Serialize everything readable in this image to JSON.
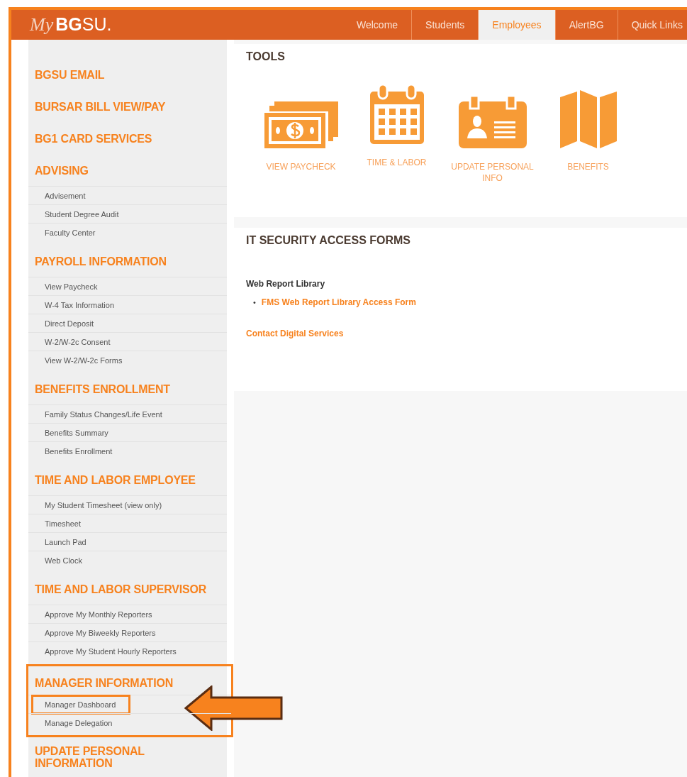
{
  "header": {
    "logo": {
      "prefix": "My",
      "name": "**BG**SU."
    },
    "tabs": [
      {
        "label": "Welcome",
        "selected": false
      },
      {
        "label": "Students",
        "selected": false
      },
      {
        "label": "Employees",
        "selected": true
      },
      {
        "label": "AlertBG",
        "selected": false
      },
      {
        "label": "Quick Links",
        "selected": false
      }
    ]
  },
  "sidebar": {
    "sections": [
      {
        "heading": "BGSU EMAIL",
        "highlighted": false
      },
      {
        "heading": "BURSAR BILL VIEW/PAY",
        "highlighted": false
      },
      {
        "heading": "BG1 CARD SERVICES",
        "highlighted": false
      },
      {
        "heading": "ADVISING",
        "highlighted": false,
        "items": [
          {
            "label": "Advisement",
            "highlighted": false
          },
          {
            "label": "Student Degree Audit",
            "highlighted": false
          },
          {
            "label": "Faculty Center",
            "highlighted": false
          }
        ]
      },
      {
        "heading": "PAYROLL INFORMATION",
        "highlighted": false,
        "items": [
          {
            "label": "View Paycheck",
            "highlighted": false
          },
          {
            "label": "W-4 Tax Information",
            "highlighted": false
          },
          {
            "label": "Direct Deposit",
            "highlighted": false
          },
          {
            "label": "W-2/W-2c Consent",
            "highlighted": false
          },
          {
            "label": "View W-2/W-2c Forms",
            "highlighted": false
          }
        ]
      },
      {
        "heading": "BENEFITS ENROLLMENT",
        "highlighted": false,
        "items": [
          {
            "label": "Family Status Changes/Life Event",
            "highlighted": false
          },
          {
            "label": "Benefits Summary",
            "highlighted": false
          },
          {
            "label": "Benefits Enrollment",
            "highlighted": false
          }
        ]
      },
      {
        "heading": "TIME AND LABOR EMPLOYEE",
        "highlighted": false,
        "items": [
          {
            "label": "My Student Timesheet (view only)",
            "highlighted": false
          },
          {
            "label": "Timesheet",
            "highlighted": false
          },
          {
            "label": "Launch Pad",
            "highlighted": false
          },
          {
            "label": "Web Clock",
            "highlighted": false
          }
        ]
      },
      {
        "heading": "TIME AND LABOR SUPERVISOR",
        "highlighted": false,
        "items": [
          {
            "label": "Approve My Monthly Reporters",
            "highlighted": false
          },
          {
            "label": "Approve My Biweekly Reporters",
            "highlighted": false
          },
          {
            "label": "Approve My Student Hourly Reporters",
            "highlighted": false
          }
        ]
      },
      {
        "heading": "MANAGER INFORMATION",
        "highlighted": true,
        "items": [
          {
            "label": "Manager Dashboard",
            "highlighted": true,
            "pointer_arrow": true
          },
          {
            "label": "Manage Delegation",
            "highlighted": false
          }
        ]
      },
      {
        "heading": "UPDATE PERSONAL INFORMATION",
        "highlighted": false
      }
    ]
  },
  "tools": {
    "title": "TOOLS",
    "items": [
      {
        "kind": "money",
        "label": "VIEW PAYCHECK"
      },
      {
        "kind": "calendar",
        "label": "TIME & LABOR"
      },
      {
        "kind": "badge",
        "label": "UPDATE PERSONAL INFO"
      },
      {
        "kind": "map",
        "label": "BENEFITS"
      }
    ]
  },
  "it_security": {
    "title": "IT SECURITY ACCESS FORMS",
    "subheading": "Web Report Library",
    "links": [
      {
        "bullet": "•",
        "label": "FMS Web Report Library Access Form"
      }
    ],
    "contact_link": "Contact Digital Services"
  }
}
